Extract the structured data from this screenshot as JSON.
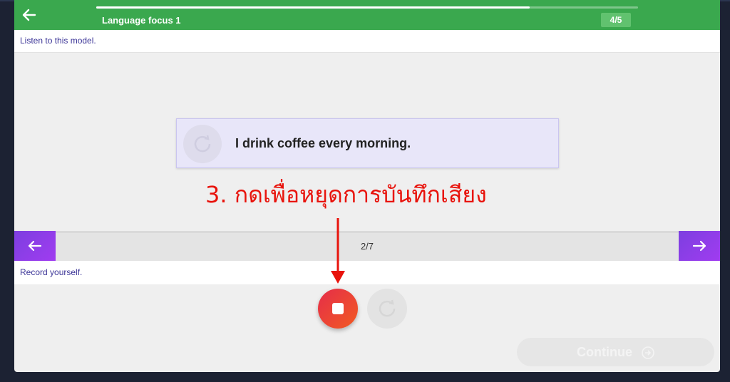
{
  "header": {
    "title": "Language focus 1",
    "counter": "4/5",
    "progress_fraction": 0.8,
    "color": "#3aa84e"
  },
  "listen": {
    "instruction": "Listen to this model."
  },
  "sentence": {
    "text": "I drink coffee every morning."
  },
  "annotation": {
    "text": "3. กดเพื่อหยุดการบันทึกเสียง",
    "color": "#e8130c"
  },
  "pager": {
    "count": "2/7",
    "prev_icon": "arrow-left-icon",
    "next_icon": "arrow-right-icon"
  },
  "record": {
    "instruction": "Record yourself.",
    "stop_icon": "stop-icon",
    "replay_icon": "replay-icon"
  },
  "footer": {
    "continue_label": "Continue"
  }
}
